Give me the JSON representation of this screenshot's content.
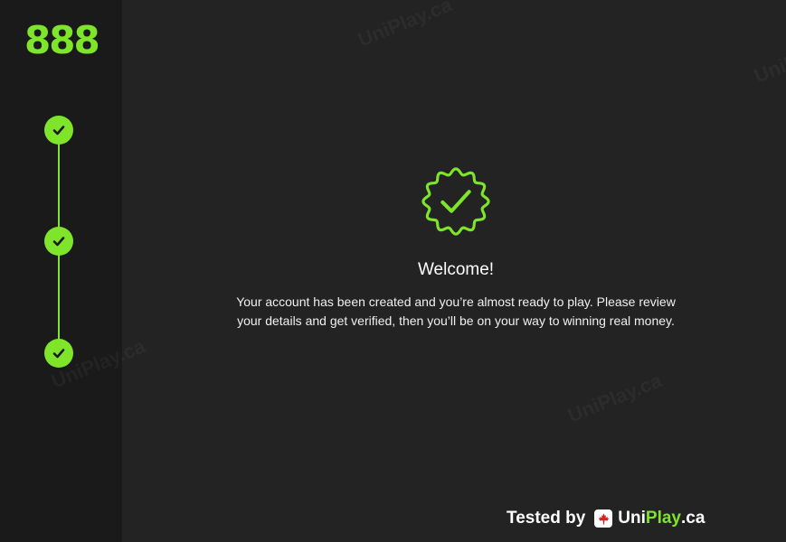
{
  "brand": {
    "logo_text": "888",
    "accent_color": "#7ee52b"
  },
  "stepper": {
    "steps": [
      {
        "state": "complete",
        "icon": "check-icon"
      },
      {
        "state": "complete",
        "icon": "check-icon"
      },
      {
        "state": "complete",
        "icon": "check-icon"
      }
    ]
  },
  "welcome": {
    "badge_icon": "verified-badge-icon",
    "title": "Welcome!",
    "message": "Your account has been created and you’re almost ready to play. Please review your details and get verified, then you’ll be on your way to winning real money."
  },
  "watermarks": [
    "UniPlay.ca",
    "UniPlay.ca",
    "UniPlay.ca",
    "UniPlay.ca"
  ],
  "footer": {
    "tested_by": "Tested by",
    "brand_uni": "Uni",
    "brand_play": "Play",
    "brand_tld": ".ca",
    "flag_icon": "maple-leaf-icon"
  }
}
